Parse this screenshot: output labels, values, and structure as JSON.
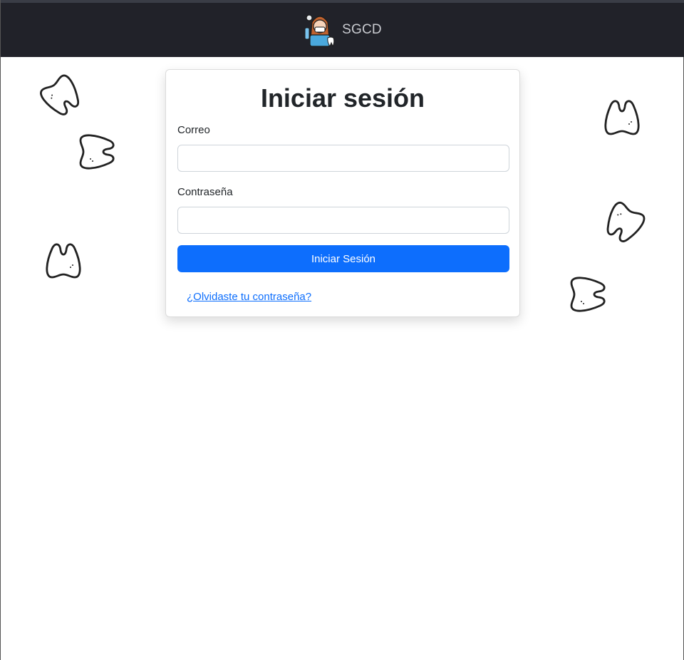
{
  "navbar": {
    "brand_name": "SGCD",
    "logo_icon": "dentist-avatar-icon"
  },
  "login": {
    "title": "Iniciar sesión",
    "email_label": "Correo",
    "email_value": "",
    "password_label": "Contraseña",
    "password_value": "",
    "submit_label": "Iniciar Sesión",
    "forgot_link": "¿Olvidaste tu contraseña?"
  },
  "decorations": {
    "icon": "tooth-icon",
    "count": 6
  },
  "colors": {
    "navbar_bg": "#212229",
    "primary": "#0d6efd",
    "text": "#212529"
  }
}
